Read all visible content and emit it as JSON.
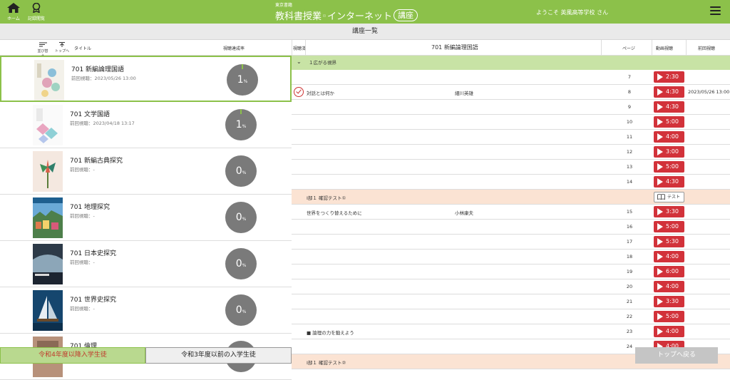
{
  "header": {
    "home_label": "ホーム",
    "record_label": "記録閲覧",
    "publisher": "東京書籍",
    "title_a": "教科書授業",
    "title_b": "インターネット",
    "badge": "講座",
    "welcome": "ようこそ  英風高等学校  さん",
    "accent": "#8cc14a"
  },
  "subbar": {
    "title": "講座一覧"
  },
  "list_header": {
    "sort": "並び替え",
    "top": "トップへ",
    "title": "タイトル",
    "rate": "視聴達成率"
  },
  "courses": [
    {
      "name": "701 新編論理国語",
      "last": "前回視聴：2023/05/26 13:00",
      "pct": "1",
      "unit": "%"
    },
    {
      "name": "701 文学国語",
      "last": "前回視聴：2023/04/18 13:17",
      "pct": "1",
      "unit": "%"
    },
    {
      "name": "701 新編古典探究",
      "last": "前回視聴：-",
      "pct": "0",
      "unit": "%"
    },
    {
      "name": "701 地理探究",
      "last": "前回視聴：-",
      "pct": "0",
      "unit": "%"
    },
    {
      "name": "701 日本史探究",
      "last": "前回視聴：-",
      "pct": "0",
      "unit": "%"
    },
    {
      "name": "701 世界史探究",
      "last": "前回視聴：-",
      "pct": "0",
      "unit": "%"
    },
    {
      "name": "701 倫理",
      "last": "",
      "pct": "",
      "unit": ""
    }
  ],
  "tabs": {
    "a": "令和4年度以降入学生徒",
    "b": "令和3年度以前の入学生徒"
  },
  "table_header": {
    "watched": "視聴済",
    "course": "701 新編論理国語",
    "page": "ページ",
    "video": "動画視聴",
    "last": "前回視聴"
  },
  "chapter": {
    "label": "１広がる視界",
    "toggle": "⌄"
  },
  "rows": [
    {
      "type": "video",
      "title": "",
      "author": "",
      "page": "7",
      "time": "2:30",
      "last": "",
      "done": false
    },
    {
      "type": "video",
      "title": "対話とは何か",
      "author": "細川英雄",
      "page": "8",
      "time": "4:30",
      "last": "2023/05/26 13:00",
      "done": true
    },
    {
      "type": "video",
      "title": "",
      "author": "",
      "page": "9",
      "time": "4:30",
      "last": "",
      "done": false
    },
    {
      "type": "video",
      "title": "",
      "author": "",
      "page": "10",
      "time": "5:00",
      "last": "",
      "done": false
    },
    {
      "type": "video",
      "title": "",
      "author": "",
      "page": "11",
      "time": "4:00",
      "last": "",
      "done": false
    },
    {
      "type": "video",
      "title": "",
      "author": "",
      "page": "12",
      "time": "3:00",
      "last": "",
      "done": false
    },
    {
      "type": "video",
      "title": "",
      "author": "",
      "page": "13",
      "time": "5:00",
      "last": "",
      "done": false
    },
    {
      "type": "video",
      "title": "",
      "author": "",
      "page": "14",
      "time": "4:30",
      "last": "",
      "done": false
    },
    {
      "type": "test",
      "title": "Ⅰ部１ 確認テスト①",
      "btn": "テスト"
    },
    {
      "type": "video",
      "title": "世界をつくり替えるために",
      "author": "小林康夫",
      "page": "15",
      "time": "3:30",
      "last": "",
      "done": false
    },
    {
      "type": "video",
      "title": "",
      "author": "",
      "page": "16",
      "time": "5:00",
      "last": "",
      "done": false
    },
    {
      "type": "video",
      "title": "",
      "author": "",
      "page": "17",
      "time": "5:30",
      "last": "",
      "done": false
    },
    {
      "type": "video",
      "title": "",
      "author": "",
      "page": "18",
      "time": "4:00",
      "last": "",
      "done": false
    },
    {
      "type": "video",
      "title": "",
      "author": "",
      "page": "19",
      "time": "6:00",
      "last": "",
      "done": false
    },
    {
      "type": "video",
      "title": "",
      "author": "",
      "page": "20",
      "time": "4:00",
      "last": "",
      "done": false
    },
    {
      "type": "video",
      "title": "",
      "author": "",
      "page": "21",
      "time": "3:30",
      "last": "",
      "done": false
    },
    {
      "type": "video",
      "title": "",
      "author": "",
      "page": "22",
      "time": "5:00",
      "last": "",
      "done": false
    },
    {
      "type": "video",
      "title": "■ 論理の力を鍛えよう",
      "author": "",
      "page": "23",
      "time": "4:00",
      "last": "",
      "done": false
    },
    {
      "type": "video",
      "title": "",
      "author": "",
      "page": "24",
      "time": "4:00",
      "last": "",
      "done": false
    },
    {
      "type": "test",
      "title": "Ⅰ部１ 確認テスト②",
      "btn": ""
    }
  ],
  "totop": "トップへ戻る"
}
